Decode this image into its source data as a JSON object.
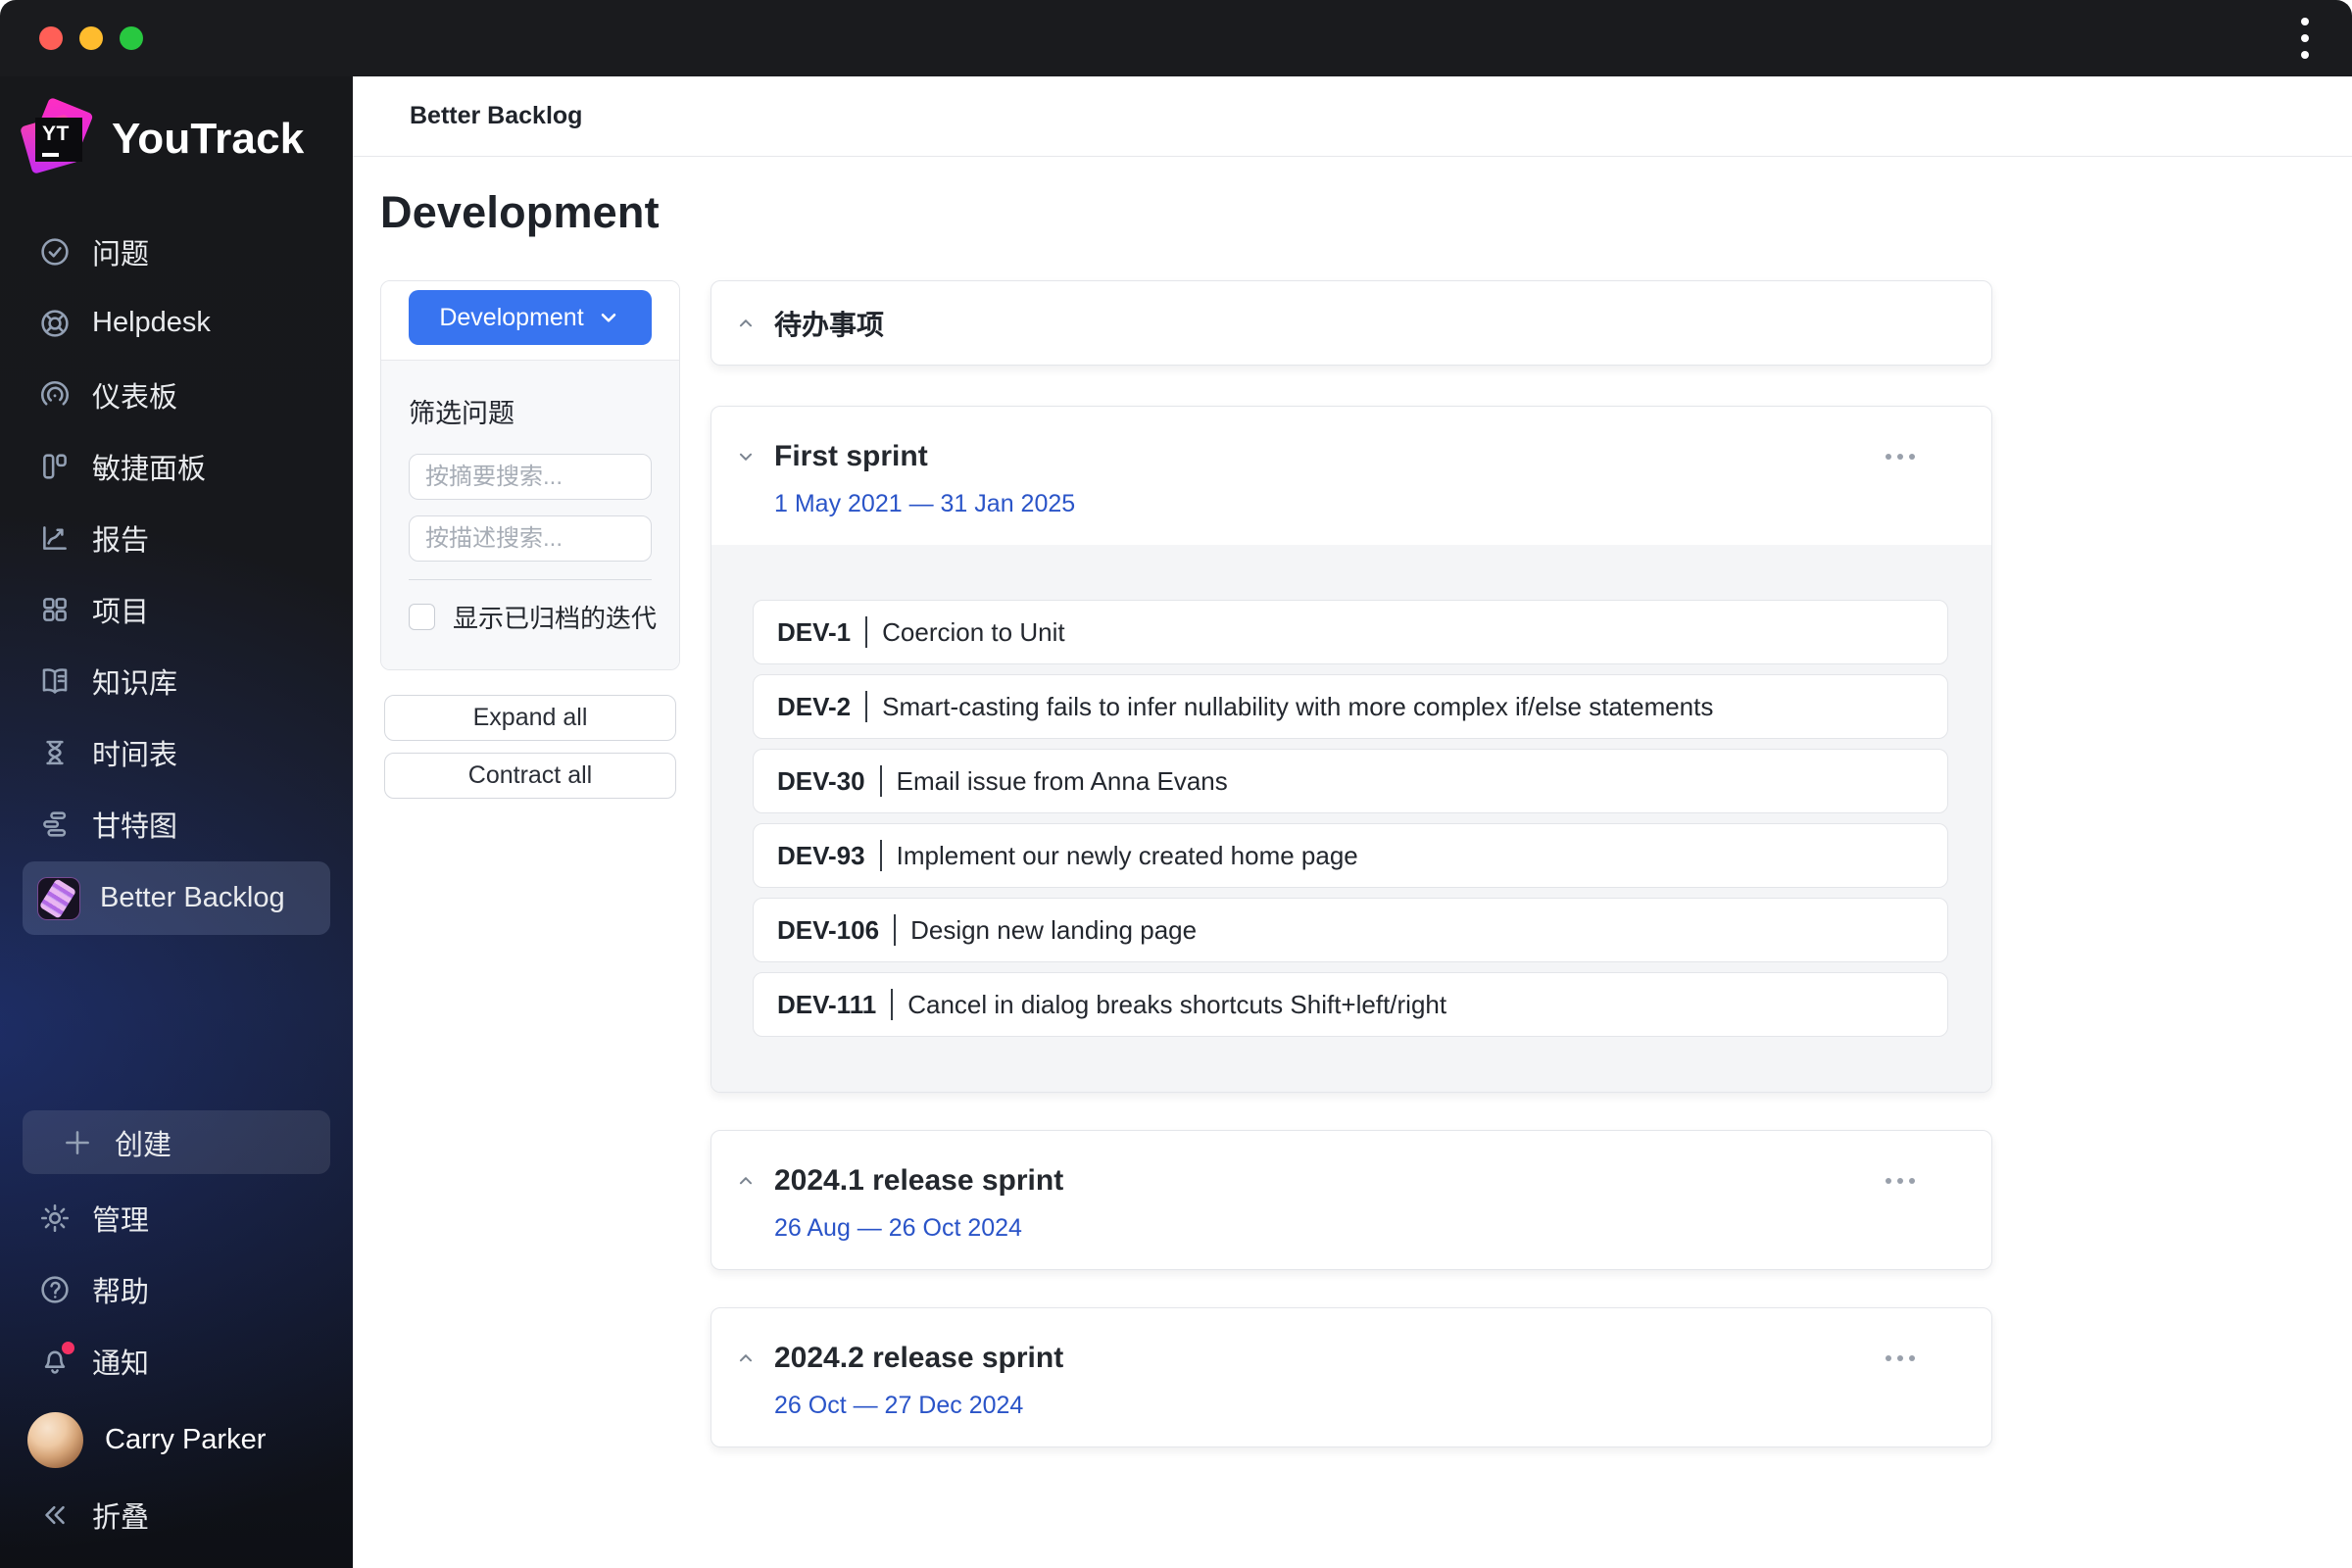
{
  "window": {
    "traffic_lights": [
      "close",
      "minimize",
      "zoom"
    ],
    "kebab_menu": "more-options"
  },
  "sidebar": {
    "logo_text": "YouTrack",
    "logo_monogram": "YT",
    "items": [
      {
        "label": "问题",
        "icon": "task-check-icon"
      },
      {
        "label": "Helpdesk",
        "icon": "lifebuoy-icon"
      },
      {
        "label": "仪表板",
        "icon": "gauge-icon"
      },
      {
        "label": "敏捷面板",
        "icon": "agile-board-icon"
      },
      {
        "label": "报告",
        "icon": "report-chart-icon"
      },
      {
        "label": "项目",
        "icon": "projects-grid-icon"
      },
      {
        "label": "知识库",
        "icon": "knowledge-book-icon"
      },
      {
        "label": "时间表",
        "icon": "hourglass-icon"
      },
      {
        "label": "甘特图",
        "icon": "gantt-icon"
      },
      {
        "label": "Better Backlog",
        "icon": "better-backlog-app-icon",
        "selected": true
      }
    ],
    "create_label": "创建",
    "admin_label": "管理",
    "help_label": "帮助",
    "notifications_label": "通知",
    "notifications_unread": true,
    "user": {
      "name": "Carry Parker"
    },
    "collapse_label": "折叠"
  },
  "header": {
    "title": "Better Backlog"
  },
  "page": {
    "title": "Development"
  },
  "filter_panel": {
    "project_button": "Development",
    "filter_label": "筛选问题",
    "summary_placeholder": "按摘要搜索...",
    "description_placeholder": "按描述搜索...",
    "summary_value": "",
    "description_value": "",
    "archived_checkbox_label": "显示已归档的迭代",
    "archived_checked": false,
    "expand_all": "Expand all",
    "contract_all": "Contract all"
  },
  "backlog": {
    "section_title": "待办事项",
    "sprints": [
      {
        "name": "First sprint",
        "dates": "1 May 2021 — 31 Jan 2025",
        "expanded": true,
        "issues": [
          {
            "id": "DEV-1",
            "title": "Coercion to Unit"
          },
          {
            "id": "DEV-2",
            "title": "Smart-casting fails to infer nullability with more complex if/else statements"
          },
          {
            "id": "DEV-30",
            "title": "Email issue from Anna Evans"
          },
          {
            "id": "DEV-93",
            "title": "Implement our newly created home page"
          },
          {
            "id": "DEV-106",
            "title": "Design new landing page"
          },
          {
            "id": "DEV-111",
            "title": "Cancel in dialog breaks shortcuts Shift+left/right"
          }
        ]
      },
      {
        "name": "2024.1 release sprint",
        "dates": "26 Aug — 26 Oct 2024",
        "expanded": false,
        "issues": []
      },
      {
        "name": "2024.2 release sprint",
        "dates": "26 Oct — 27 Dec 2024",
        "expanded": false,
        "issues": []
      }
    ]
  },
  "colors": {
    "accent_blue": "#3874f0",
    "link_blue": "#2a54c8",
    "notification_red": "#f43164",
    "traffic_red": "#ff5f57",
    "traffic_yellow": "#febc2e",
    "traffic_green": "#28c840"
  }
}
